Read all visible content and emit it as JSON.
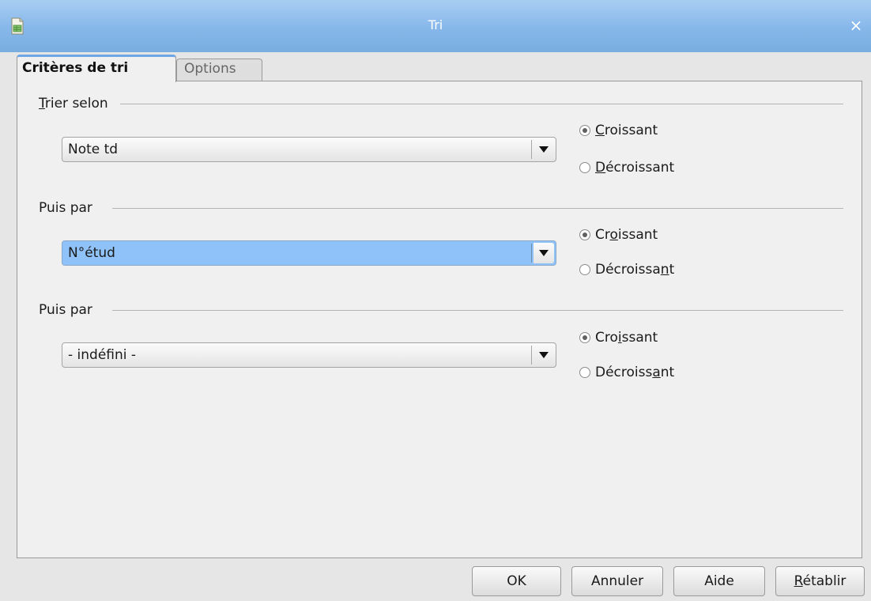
{
  "window": {
    "title": "Tri",
    "close_label": "×"
  },
  "tabs": [
    {
      "label": "Critères de tri",
      "active": true
    },
    {
      "label": "Options",
      "active": false
    }
  ],
  "sort_keys": [
    {
      "label": "Trier selon",
      "value": "Note td",
      "ascending_label": "Croissant",
      "descending_label": "Décroissant",
      "selected": "ascending",
      "highlighted": false
    },
    {
      "label": "Puis par",
      "value": "N°étud",
      "ascending_label": "Croissant",
      "descending_label": "Décroissant",
      "selected": "ascending",
      "highlighted": true
    },
    {
      "label": "Puis par",
      "value": "- indéfini -",
      "ascending_label": "Croissant",
      "descending_label": "Décroissant",
      "selected": "ascending",
      "highlighted": false
    }
  ],
  "buttons": {
    "ok": "OK",
    "cancel": "Annuler",
    "help": "Aide",
    "reset": "Rétablir"
  },
  "colors": {
    "titlebar": "#86b7ea",
    "tab_accent": "#6fa7e6",
    "selection": "#8fc2f8"
  }
}
